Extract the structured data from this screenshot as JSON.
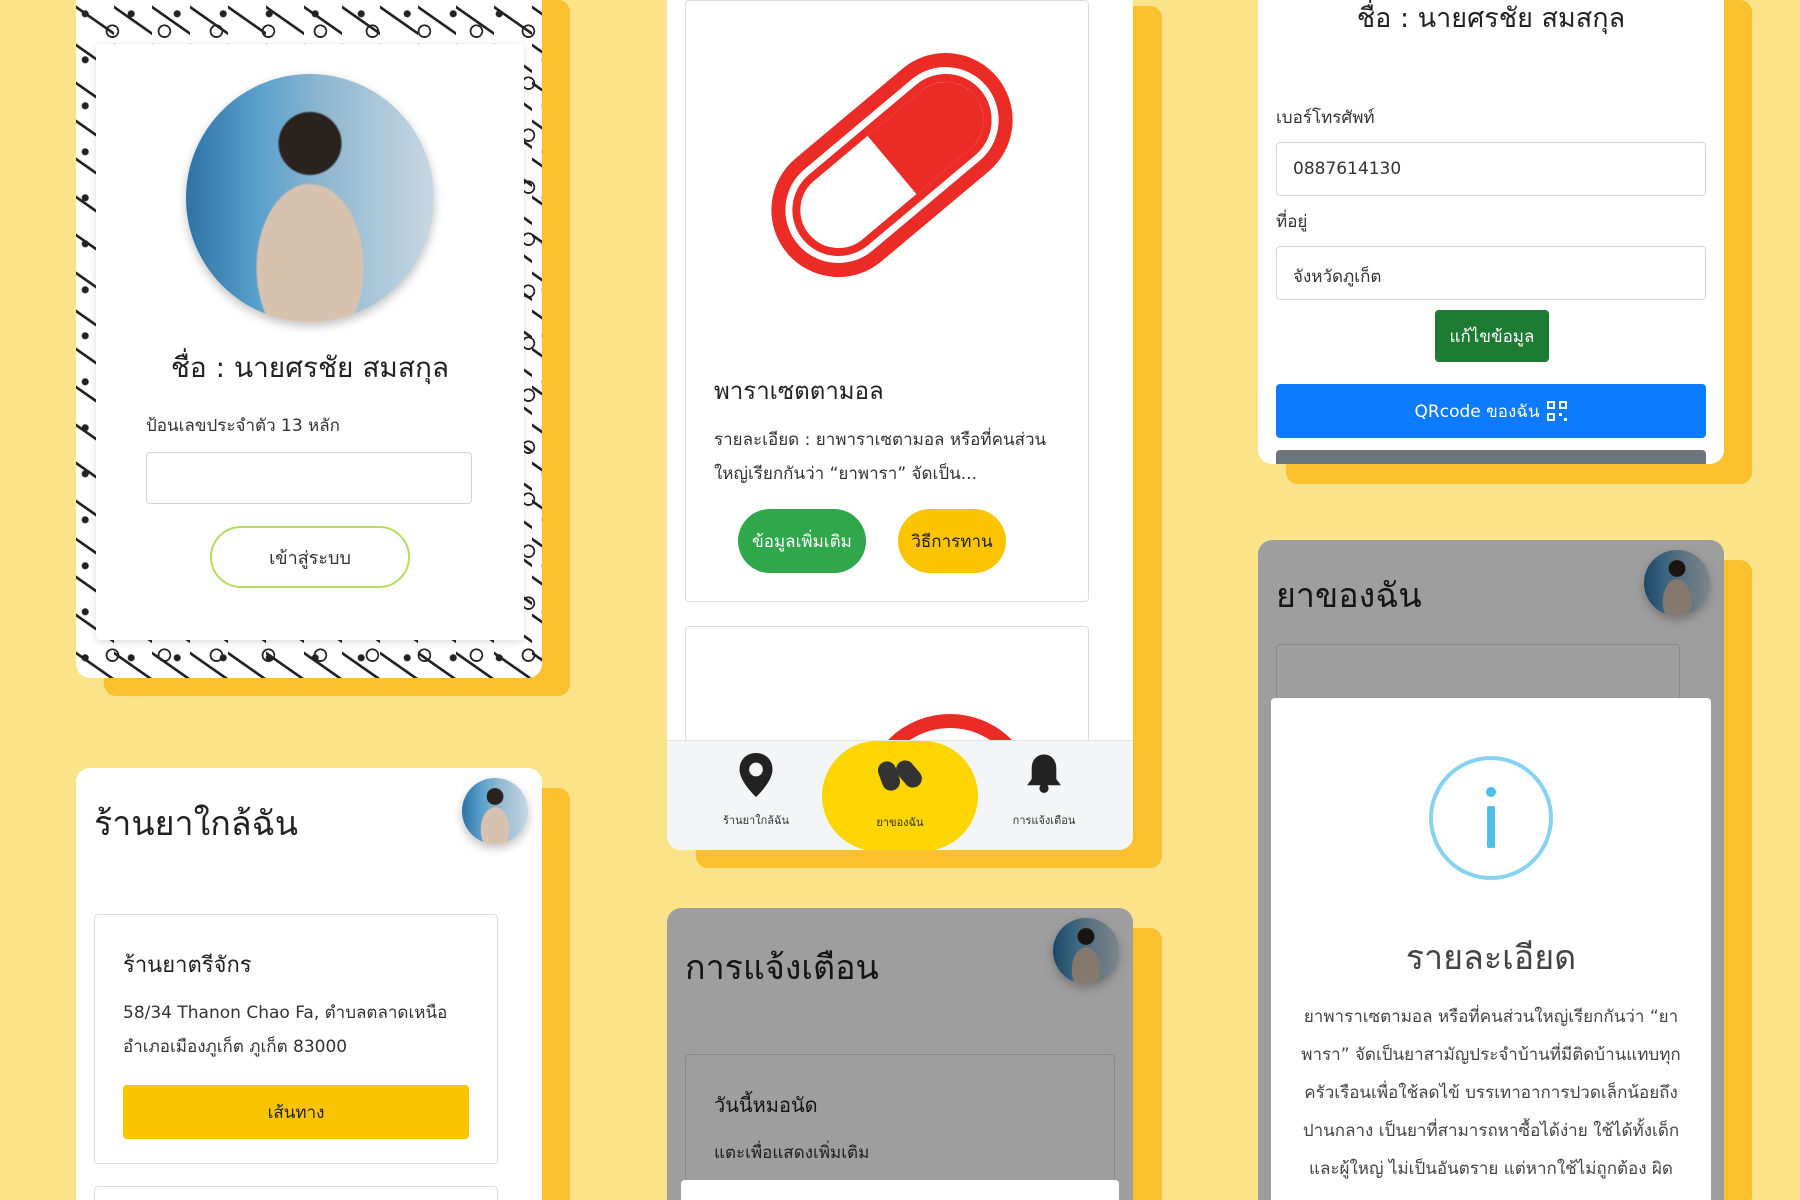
{
  "login": {
    "name": "ชื่อ : นายศรชัย สมสกุล",
    "id_label": "ป้อนเลขประจำตัว 13 หลัก",
    "id_value": "",
    "login_button": "เข้าสู่ระบบ"
  },
  "medicine": {
    "drug_name": "พาราเซตตามอล",
    "drug_detail": "รายละเอียด : ยาพาราเซตามอล หรือที่คนส่วนใหญ่เรียกกันว่า “ยาพารา” จัดเป็น...",
    "more_info_button": "ข้อมูลเพิ่มเติม",
    "howto_button": "วิธีการทาน",
    "nav": {
      "pharmacy": "ร้านยาใกล้ฉัน",
      "my_medicine": "ยาของฉัน",
      "notifications": "การแจ้งเตือน"
    }
  },
  "profile": {
    "name": "ชื่อ : นายศรชัย สมสกุล",
    "phone_label": "เบอร์โทรศัพท์",
    "phone_value": "0887614130",
    "address_label": "ที่อยู่",
    "address_value": "จังหวัดภูเก็ต",
    "edit_button": "แก้ไขข้อมูล",
    "qr_button": "QRcode ของฉัน"
  },
  "pharmacy": {
    "title": "ร้านยาใกล้ฉัน",
    "store_name": "ร้านยาตรีจักร",
    "store_address_line1": "58/34 Thanon Chao Fa, ตำบลตลาดเหนือ",
    "store_address_line2": "อำเภอเมืองภูเก็ต ภูเก็ต 83000",
    "route_button": "เส้นทาง"
  },
  "notifications": {
    "title": "การแจ้งเตือน",
    "item_title": "วันนี้หมอนัด",
    "item_sub": "แตะเพื่อแสดงเพิ่มเติม"
  },
  "mymed": {
    "title": "ยาของฉัน",
    "modal_title": "รายละเอียด",
    "modal_body": "ยาพาราเซตามอล หรือที่คนส่วนใหญ่เรียกกันว่า “ยาพารา” จัดเป็นยาสามัญประจำบ้านที่มีติดบ้านแทบทุกครัวเรือนเพื่อใช้ลดไข้ บรรเทาอาการปวดเล็กน้อยถึงปานกลาง เป็นยาที่สามารถหาซื้อได้ง่าย ใช้ได้ทั้งเด็กและผู้ใหญ่ ไม่เป็นอันตราย แต่หากใช้ไม่ถูกต้อง ผิดขนาด"
  },
  "colors": {
    "background": "#fbe38a",
    "accent_shadow": "#fbc02d",
    "green": "#2fa74a",
    "yellow": "#fbc400",
    "blue": "#0d7bff",
    "dark_green": "#1e7b34",
    "info_ring": "#86d3f0",
    "pill_red": "#ea2b26"
  }
}
